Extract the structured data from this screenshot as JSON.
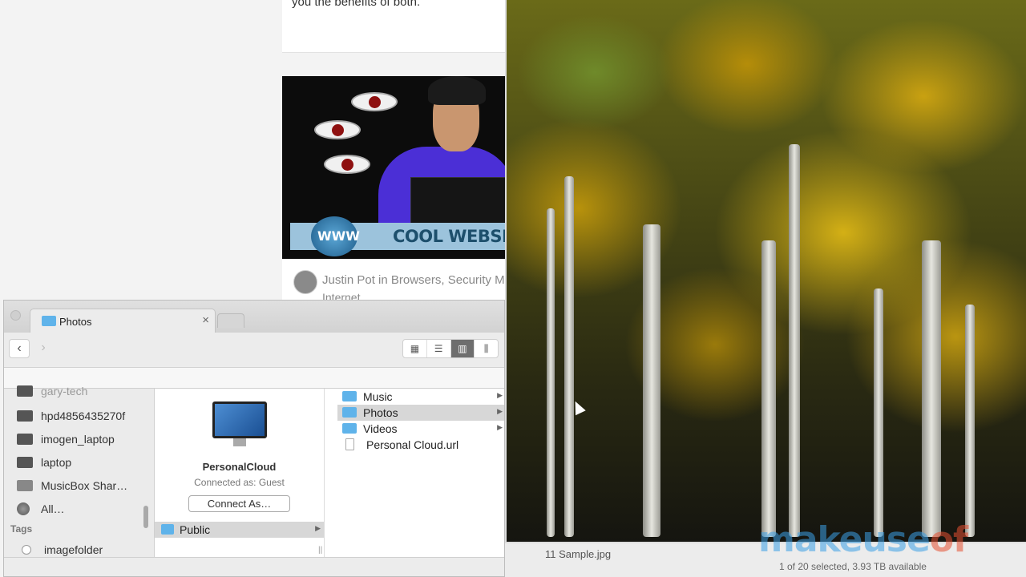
{
  "webpage": {
    "card_text": "you the benefits of both.",
    "article_image": {
      "banner_www": "WWW",
      "banner_text": "COOL WEBSITE"
    },
    "author_line": "Justin Pot in Browsers, Security M",
    "author_line2": "Internet"
  },
  "finder": {
    "tab_title": "Photos",
    "tab_close": "×",
    "nav": {
      "back": "‹",
      "forward": "›"
    },
    "view_buttons": [
      "▦",
      "☰",
      "▥",
      "⫼"
    ],
    "sidebar": {
      "items": [
        {
          "label": "gary-tech",
          "icon": "computer-icon"
        },
        {
          "label": "hpd4856435270f",
          "icon": "computer-icon"
        },
        {
          "label": "imogen_laptop",
          "icon": "computer-icon"
        },
        {
          "label": "laptop",
          "icon": "computer-icon"
        },
        {
          "label": "MusicBox Shar…",
          "icon": "computer-icon"
        },
        {
          "label": "All…",
          "icon": "globe-icon"
        }
      ],
      "tags_heading": "Tags",
      "tags": [
        {
          "label": "imagefolder",
          "icon": "tag-icon"
        }
      ]
    },
    "server": {
      "name": "PersonalCloud",
      "connected_as": "Connected as: Guest",
      "connect_button": "Connect As…",
      "folders": [
        {
          "label": "Public",
          "selected": true
        }
      ]
    },
    "columns": {
      "items": [
        {
          "label": "Music",
          "type": "folder",
          "selected": false
        },
        {
          "label": "Photos",
          "type": "folder",
          "selected": true
        },
        {
          "label": "Videos",
          "type": "folder",
          "selected": false
        },
        {
          "label": "Personal Cloud.url",
          "type": "file",
          "selected": false
        }
      ]
    },
    "status": "1 of 20 selected, 3.93 TB available",
    "hidden_file": "11 Sample.jpg"
  },
  "watermark": {
    "part1": "makeuse",
    "part2": "of"
  },
  "colors": {
    "folder": "#5fb3ea",
    "selection": "#d7d7d7",
    "accent_blue": "#3ca0e6",
    "accent_red": "#e65032"
  }
}
